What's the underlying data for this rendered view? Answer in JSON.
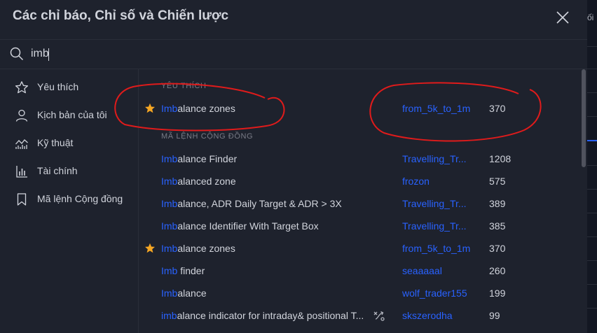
{
  "dialog": {
    "title": "Các chỉ báo, Chỉ số và Chiến lược",
    "close_icon": "close-icon"
  },
  "search": {
    "value": "imb",
    "icon": "search-icon"
  },
  "right_strip": {
    "text": "ối"
  },
  "sidebar": {
    "items": [
      {
        "label": "Yêu thích",
        "icon": "star-outline-icon"
      },
      {
        "label": "Kịch bản của tôi",
        "icon": "user-icon"
      },
      {
        "label": "Kỹ thuật",
        "icon": "chart-line-icon"
      },
      {
        "label": "Tài chính",
        "icon": "bar-chart-icon"
      },
      {
        "label": "Mã lệnh Cộng đồng",
        "icon": "bookmark-icon"
      }
    ]
  },
  "favorites": {
    "heading": "YÊU THÍCH",
    "rows": [
      {
        "match": "Imb",
        "rest": "alance zones",
        "author": "from_5k_to_1m",
        "count": "370",
        "starred": true
      }
    ]
  },
  "community": {
    "heading": "MÃ LỆNH CỘNG ĐỒNG",
    "rows": [
      {
        "match": "Imb",
        "rest": "alance Finder",
        "author": "Travelling_Tr...",
        "count": "1208",
        "starred": false
      },
      {
        "match": "Imb",
        "rest": "alanced zone",
        "author": "frozon",
        "count": "575",
        "starred": false
      },
      {
        "match": "Imb",
        "rest": "alance, ADR Daily Target & ADR > 3X",
        "author": "Travelling_Tr...",
        "count": "389",
        "starred": false
      },
      {
        "match": "Imb",
        "rest": "alance Identifier With Target Box",
        "author": "Travelling_Tr...",
        "count": "385",
        "starred": false
      },
      {
        "match": "Imb",
        "rest": "alance zones",
        "author": "from_5k_to_1m",
        "count": "370",
        "starred": true
      },
      {
        "match": "Imb",
        "rest": " finder",
        "author": "seaaaaal",
        "count": "260",
        "starred": false
      },
      {
        "match": "Imb",
        "rest": "alance",
        "author": "wolf_trader155",
        "count": "199",
        "starred": false
      },
      {
        "match": "imb",
        "rest": "alance indicator for intraday& positional T...",
        "author": "skszerodha",
        "count": "99",
        "starred": false
      }
    ]
  },
  "colors": {
    "accent": "#2962ff",
    "star": "#f5a623",
    "annotation": "#e01b1b"
  }
}
